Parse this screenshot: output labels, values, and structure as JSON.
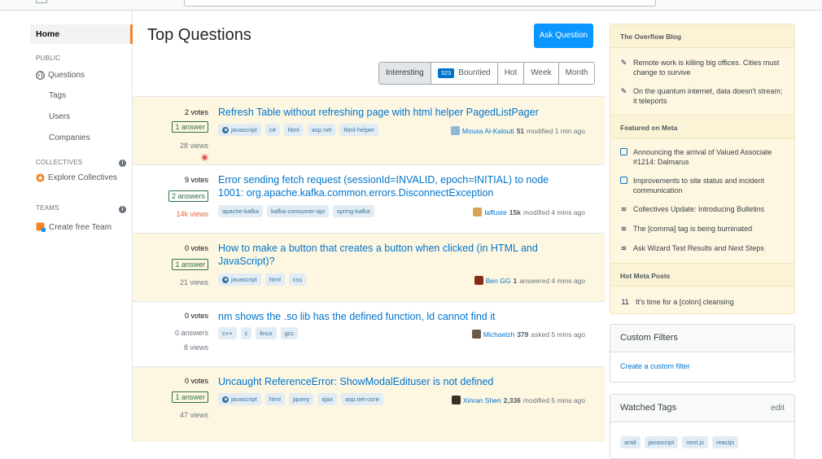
{
  "nav": {
    "home": "Home",
    "public": "PUBLIC",
    "questions": "Questions",
    "tags": "Tags",
    "users": "Users",
    "companies": "Companies",
    "collectives": "COLLECTIVES",
    "explore_collectives": "Explore Collectives",
    "teams": "TEAMS",
    "create_team": "Create free Team"
  },
  "main": {
    "title": "Top Questions",
    "ask_button": "Ask Question",
    "filters": {
      "interesting": "Interesting",
      "bountied_count": "323",
      "bountied": "Bountied",
      "hot": "Hot",
      "week": "Week",
      "month": "Month"
    },
    "questions": [
      {
        "votes": "2 votes",
        "answers": "1 answer",
        "views": "28 views",
        "title": "Refresh Table without refreshing page with html helper PagedListPager",
        "tags": [
          "javascript",
          "c#",
          "html",
          "asp.net",
          "html-helper"
        ],
        "user": "Mousa Al-Kalouti",
        "rep": "51",
        "action": "modified 1 min ago"
      },
      {
        "votes": "9 votes",
        "answers": "2 answers",
        "views": "14k views",
        "title": "Error sending fetch request (sessionId=INVALID, epoch=INITIAL) to node 1001: org.apache.kafka.common.errors.DisconnectException",
        "tags": [
          "apache-kafka",
          "kafka-consumer-api",
          "spring-kafka"
        ],
        "user": "laffuste",
        "rep": "15k",
        "action": "modified 4 mins ago"
      },
      {
        "votes": "0 votes",
        "answers": "1 answer",
        "views": "21 views",
        "title": "How to make a button that creates a button when clicked (in HTML and JavaScript)?",
        "tags": [
          "javascript",
          "html",
          "css"
        ],
        "user": "Ben GG",
        "rep": "1",
        "action": "answered 4 mins ago"
      },
      {
        "votes": "0 votes",
        "answers": "0 answers",
        "views": "8 views",
        "title": "nm shows the .so lib has the defined function, ld cannot find it",
        "tags": [
          "c++",
          "c",
          "linux",
          "gcc"
        ],
        "user": "Michaelzh",
        "rep": "379",
        "action": "asked 5 mins ago"
      },
      {
        "votes": "0 votes",
        "answers": "1 answer",
        "views": "47 views",
        "title": "Uncaught ReferenceError: ShowModalEdituser is not defined",
        "tags": [
          "javascript",
          "html",
          "jquery",
          "ajax",
          "asp.net-core"
        ],
        "user": "Xinran Shen",
        "rep": "2,336",
        "action": "modified 5 mins ago"
      }
    ]
  },
  "sidebar": {
    "blog_title": "The Overflow Blog",
    "blog_items": [
      "Remote work is killing big offices. Cities must change to survive",
      "On the quantum internet, data doesn't stream; it teleports"
    ],
    "meta_title": "Featured on Meta",
    "meta_items": [
      "Announcing the arrival of Valued Associate #1214: Dalmarus",
      "Improvements to site status and incident communication",
      "Collectives Update: Introducing Bulletins",
      "The [comma] tag is being burninated",
      "Ask Wizard Test Results and Next Steps"
    ],
    "hot_title": "Hot Meta Posts",
    "hot_count": "11",
    "hot_item": "It's time for a [colon] cleansing",
    "custom_filters_title": "Custom Filters",
    "custom_filters_link": "Create a custom filter",
    "watched_title": "Watched Tags",
    "watched_edit": "edit",
    "watched_tags": [
      "antd",
      "javascript",
      "next.js",
      "reactjs"
    ]
  },
  "colors": {
    "accent": "#0a95ff",
    "link": "#0074cc",
    "highlight": "#fdf7e2",
    "nav_marker": "#f48225"
  }
}
